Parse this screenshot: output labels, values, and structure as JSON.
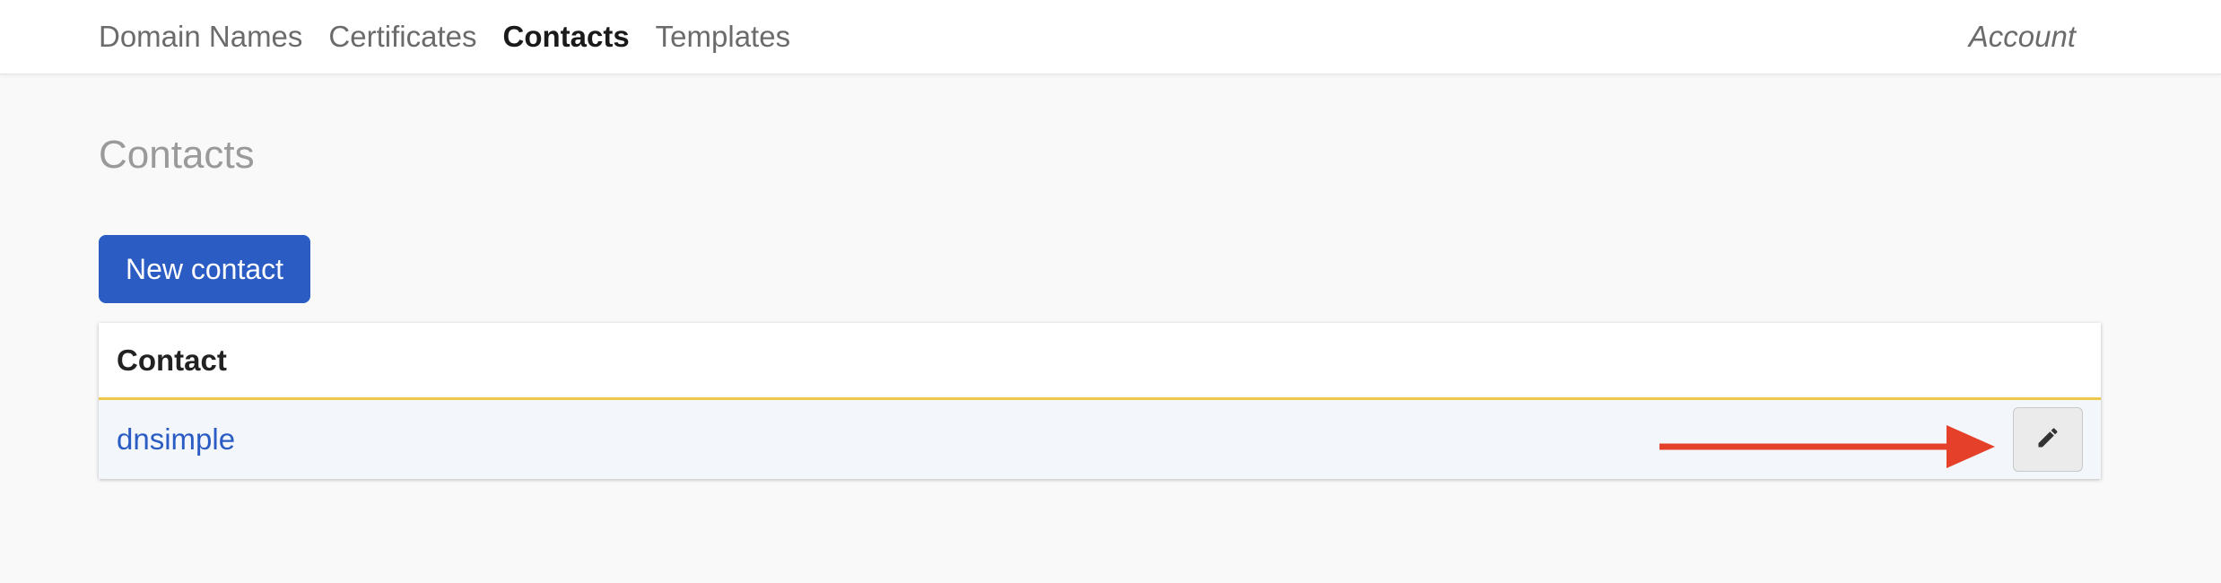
{
  "nav": {
    "items": [
      {
        "label": "Domain Names"
      },
      {
        "label": "Certificates"
      },
      {
        "label": "Contacts",
        "active": true
      },
      {
        "label": "Templates"
      }
    ],
    "account_label": "Account"
  },
  "page": {
    "title": "Contacts",
    "new_button_label": "New contact"
  },
  "table": {
    "header": "Contact",
    "rows": [
      {
        "name": "dnsimple",
        "edit_icon": "pencil-icon"
      }
    ]
  },
  "colors": {
    "primary": "#2b5cc4",
    "header_border": "#ecc94b",
    "row_bg": "#f3f7fb",
    "annotation_arrow": "#e5402a"
  }
}
